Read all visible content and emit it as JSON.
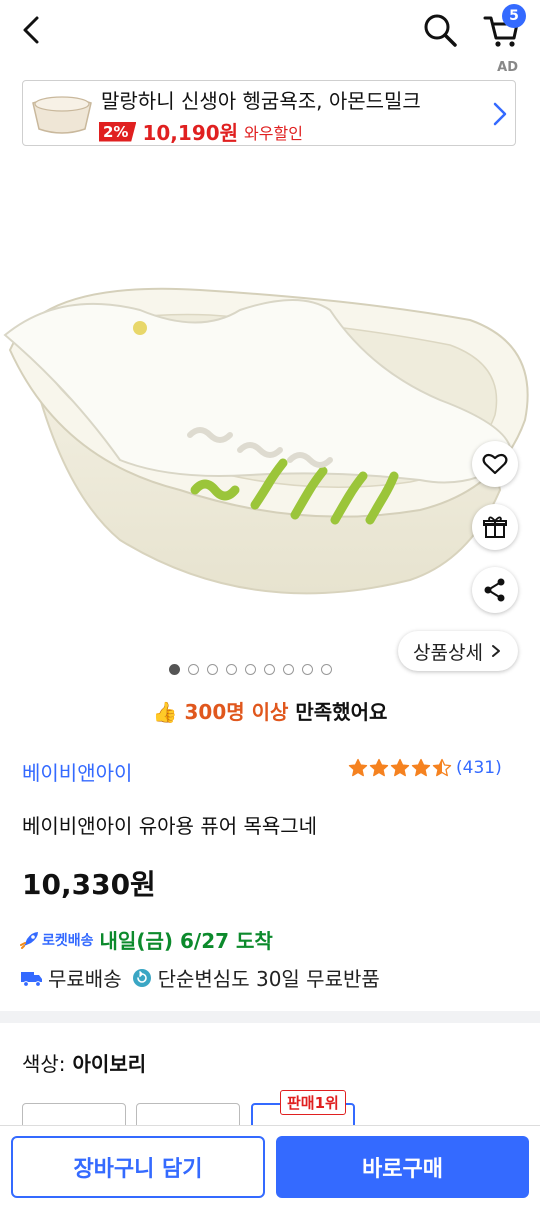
{
  "header": {
    "cart_count": "5",
    "ad_tag": "AD"
  },
  "ad_banner": {
    "title": "말랑하니 신생아 헹굼욕조, 아몬드밀크",
    "discount": "2%",
    "price": "10,190원",
    "deal_label": "와우할인"
  },
  "gallery": {
    "detail_button": "상품상세",
    "image_count": 9,
    "active_index": 0
  },
  "satisfaction": {
    "highlight": "300명 이상",
    "text": " 만족했어요"
  },
  "product": {
    "brand": "베이비앤아이",
    "rating": 4.5,
    "review_count": "(431)",
    "name": "베이비앤아이 유아용 퓨어 목욕그네",
    "price": "10,330원"
  },
  "delivery": {
    "rocket_label": "로켓배송",
    "eta": "내일(금) 6/27 도착",
    "free_shipping": "무료배송",
    "return_policy": "단순변심도 30일 무료반품"
  },
  "options": {
    "label_key": "색상:",
    "label_value": "아이보리",
    "best_badge": "판매1위"
  },
  "actions": {
    "add_to_cart": "장바구니 담기",
    "buy_now": "바로구매"
  },
  "colors": {
    "accent": "#346aff",
    "sale": "#e02020",
    "delivery_green": "#0c8a2c",
    "highlight_orange": "#e0571d"
  }
}
